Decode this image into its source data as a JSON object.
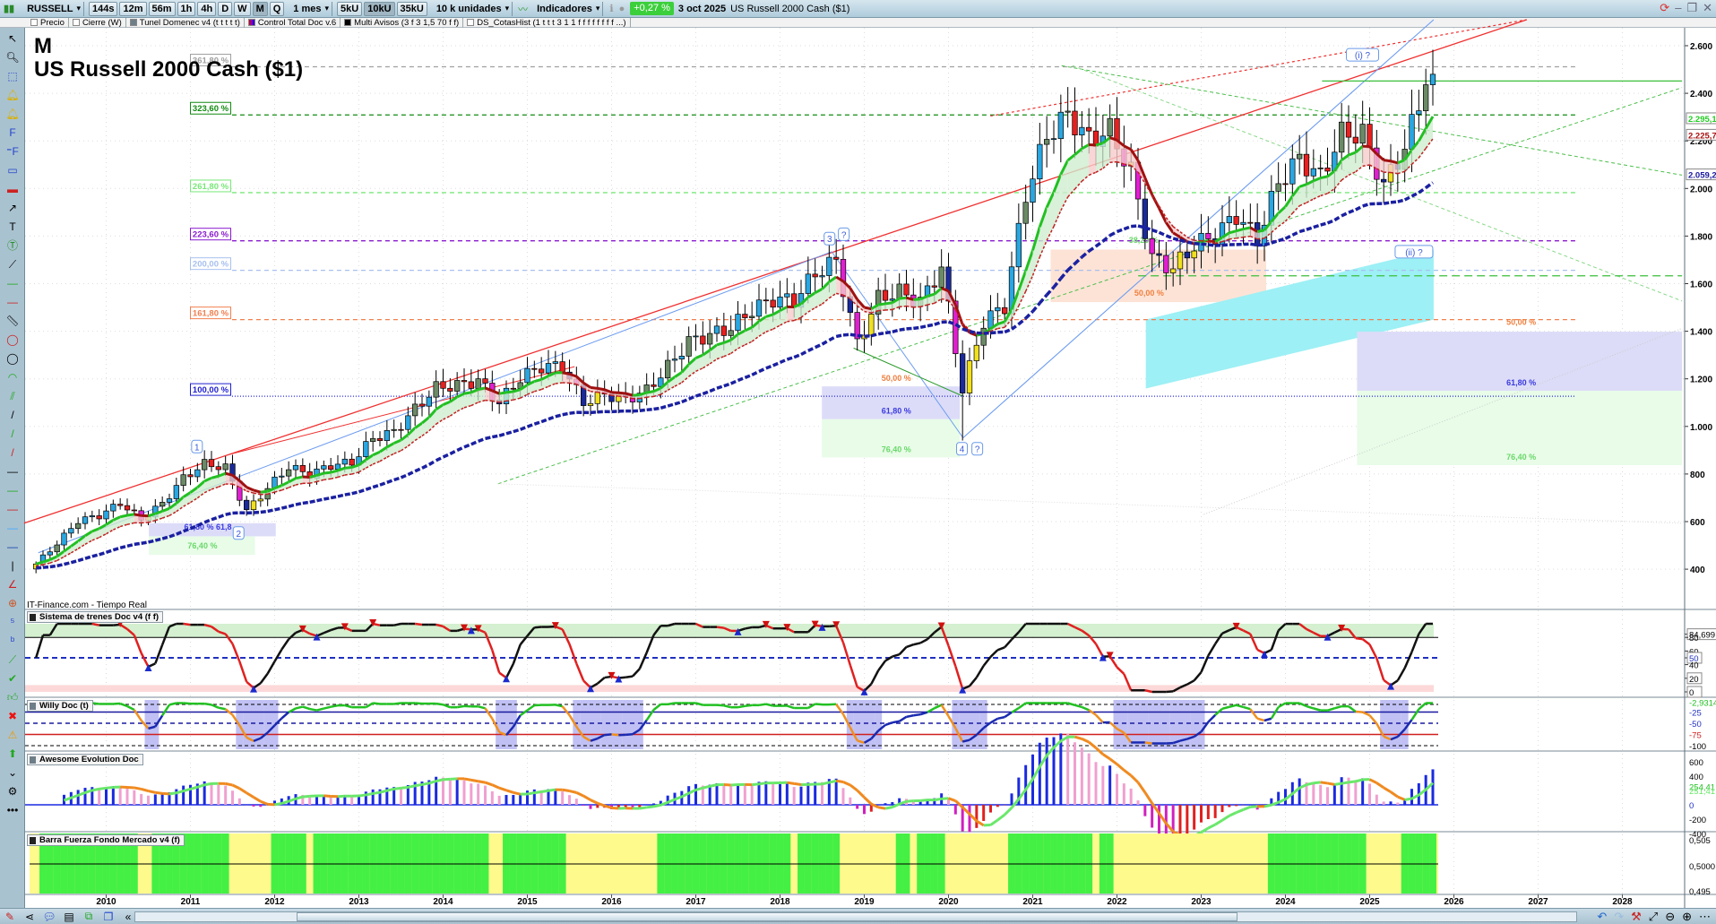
{
  "toolbar": {
    "symbol": "RUSSELL",
    "timeframes": [
      "144s",
      "12m",
      "56m",
      "1h",
      "4h",
      "D",
      "W",
      "M",
      "Q"
    ],
    "active_timeframe": "M",
    "period": "1 mes",
    "units": [
      "5kU",
      "10kU",
      "35kU"
    ],
    "active_unit": "10kU",
    "units_select": "10 k unidades",
    "indicators": "Indicadores",
    "change": "+0,27 %",
    "date": "3 oct 2025",
    "instrument": "US Russell 2000 Cash ($1)"
  },
  "indicator_bar": [
    "Precio",
    "Cierre (W)",
    "Tunel Domenec v4 (t t t t t)",
    "Control Total Doc v.6",
    "Multi Avisos (3 f 3 1,5 70 f f)",
    "DS_CotasHist (1 t t t 3 1 1 f f f f f f f f ...)"
  ],
  "chart": {
    "period_letter": "M",
    "title": "US Russell 2000 Cash ($1)",
    "source": "IT-Finance.com - Tiempo Real",
    "fib_levels": [
      {
        "label": "361,80 %",
        "color": "#a0a0a0"
      },
      {
        "label": "323,60 %",
        "color": "#108a10"
      },
      {
        "label": "261,80 %",
        "color": "#78e878"
      },
      {
        "label": "223,60 %",
        "color": "#8a1ad0"
      },
      {
        "label": "200,00 %",
        "color": "#a8c0f0"
      },
      {
        "label": "161,80 %",
        "color": "#f08050"
      },
      {
        "label": "100,00 %",
        "color": "#2020d0"
      }
    ],
    "retracement_labels": [
      "50,00 %",
      "61,80 %",
      "76,40 %",
      "38,20 %",
      "61,80 % 61,8"
    ],
    "wave_labels": [
      "1",
      "2",
      "3",
      "?",
      "4",
      "?",
      "(i) ?",
      "(ii) ?"
    ],
    "price_axis": [
      "2.600",
      "2.400",
      "2.200",
      "2.000",
      "1.800",
      "1.600",
      "1.400",
      "1.200",
      "1.000",
      "800",
      "600",
      "400"
    ],
    "price_tags": [
      {
        "text": "2.295,1",
        "color": "#22cc22"
      },
      {
        "text": "2.225,7",
        "color": "#aa1010"
      },
      {
        "text": "2.059,2",
        "color": "#1a1aa0"
      }
    ]
  },
  "chart_data": {
    "type": "candlestick",
    "title": "US Russell 2000 Cash ($1)",
    "interval": "monthly",
    "start": "2009-03",
    "quarterly_closes": [
      422,
      508,
      604,
      625,
      678,
      609,
      676,
      783,
      843,
      827,
      644,
      741,
      830,
      798,
      837,
      849,
      951,
      977,
      1073,
      1163,
      1173,
      1192,
      1101,
      1204,
      1252,
      1253,
      1100,
      1135,
      1114,
      1151,
      1251,
      1357,
      1385,
      1415,
      1490,
      1535,
      1529,
      1643,
      1696,
      1348,
      1539,
      1566,
      1523,
      1668,
      1153,
      1441,
      1507,
      1975,
      2220,
      2310,
      2204,
      2245,
      2070,
      1708,
      1665,
      1761,
      1802,
      1889,
      1785,
      2027,
      2124,
      2048,
      2230,
      2230,
      2011,
      2175,
      2436
    ],
    "last_close": 2480,
    "x_ticks": [
      "2010",
      "2011",
      "2012",
      "2013",
      "2014",
      "2015",
      "2016",
      "2017",
      "2018",
      "2019",
      "2020",
      "2021",
      "2022",
      "2023",
      "2024",
      "2025",
      "2026",
      "2027",
      "2028"
    ],
    "ylim": [
      300,
      2700
    ]
  },
  "panels": [
    {
      "title": "Sistema de trenes Doc v4 (f f)",
      "axis": [
        "84,699",
        "80",
        "60",
        "50",
        "40",
        "20",
        "0"
      ]
    },
    {
      "title": "Willy Doc (t)",
      "axis": [
        "-2,9314",
        "-25",
        "-50",
        "-75",
        "-100"
      ]
    },
    {
      "title": "Awesome Evolution Doc",
      "axis": [
        "600",
        "400",
        "254,41",
        "251,41",
        "0",
        "-200",
        "-400"
      ]
    },
    {
      "title": "Barra Fuerza Fondo Mercado v4 (f)",
      "axis": [
        "0,505",
        "0,5000",
        "0,495"
      ]
    }
  ]
}
